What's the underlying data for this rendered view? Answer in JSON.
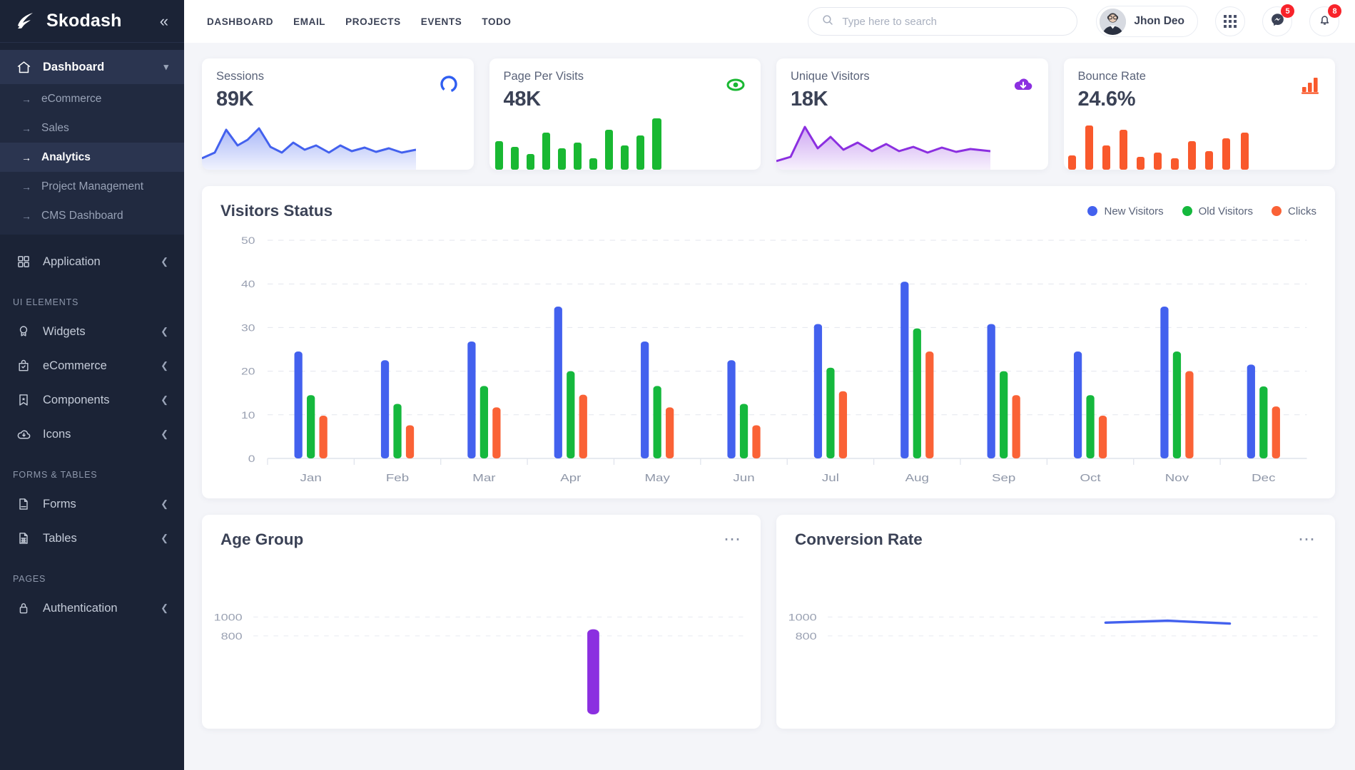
{
  "sidebar": {
    "brand": "Skodash",
    "collapse_icon": "chevron-double-left-icon",
    "groups": [
      {
        "icon": "home-icon",
        "label": "Dashboard",
        "caret": "chevron-down-icon",
        "expanded": true,
        "children": [
          {
            "label": "eCommerce",
            "selected": false
          },
          {
            "label": "Sales",
            "selected": false
          },
          {
            "label": "Analytics",
            "selected": true
          },
          {
            "label": "Project Management",
            "selected": false
          },
          {
            "label": "CMS Dashboard",
            "selected": false
          }
        ]
      }
    ],
    "application": {
      "icon": "grid-squares-icon",
      "label": "Application",
      "caret": "chevron-left-icon"
    },
    "section_ui_elements": "UI ELEMENTS",
    "ui_items": [
      {
        "icon": "badge-icon",
        "label": "Widgets",
        "caret": "chevron-left-icon"
      },
      {
        "icon": "shopping-bag-icon",
        "label": "eCommerce",
        "caret": "chevron-left-icon"
      },
      {
        "icon": "bookmark-star-icon",
        "label": "Components",
        "caret": "chevron-left-icon"
      },
      {
        "icon": "cloud-download-icon",
        "label": "Icons",
        "caret": "chevron-left-icon"
      }
    ],
    "section_forms_tables": "FORMS & TABLES",
    "forms_items": [
      {
        "icon": "file-icon",
        "label": "Forms",
        "caret": "chevron-left-icon"
      },
      {
        "icon": "table-icon",
        "label": "Tables",
        "caret": "chevron-left-icon"
      }
    ],
    "section_pages": "PAGES",
    "pages_items": [
      {
        "icon": "lock-icon",
        "label": "Authentication",
        "caret": "chevron-left-icon"
      }
    ]
  },
  "topbar": {
    "nav": [
      "DASHBOARD",
      "EMAIL",
      "PROJECTS",
      "EVENTS",
      "TODO"
    ],
    "search": {
      "placeholder": "Type here to search",
      "value": "",
      "icon": "search-icon"
    },
    "profile": {
      "name": "Jhon Deo",
      "avatar": "user-avatar"
    },
    "apps_icon": "apps-grid-icon",
    "messages": {
      "icon": "messenger-icon",
      "badge": "5"
    },
    "notifications": {
      "icon": "bell-icon",
      "badge": "8"
    }
  },
  "stats": [
    {
      "label": "Sessions",
      "value": "89K",
      "icon": "circle-ring-icon",
      "color": "#4361ee",
      "spark": "area"
    },
    {
      "label": "Page Per Visits",
      "value": "48K",
      "icon": "eye-icon",
      "color": "#19b832",
      "spark": "bars"
    },
    {
      "label": "Unique Visitors",
      "value": "18K",
      "icon": "cloud-download-icon",
      "color": "#8b2fe0",
      "spark": "area"
    },
    {
      "label": "Bounce Rate",
      "value": "24.6%",
      "icon": "bar-chart-icon",
      "color": "#f9592c",
      "spark": "bars"
    }
  ],
  "visitors_card": {
    "title": "Visitors Status",
    "legend": [
      {
        "label": "New Visitors",
        "color": "#4361ee"
      },
      {
        "label": "Old Visitors",
        "color": "#15b83d"
      },
      {
        "label": "Clicks",
        "color": "#fa6236"
      }
    ]
  },
  "bottom": {
    "age_group": {
      "title": "Age Group",
      "menu_icon": "ellipsis-icon"
    },
    "conversion_rate": {
      "title": "Conversion Rate",
      "menu_icon": "ellipsis-icon"
    }
  },
  "chart_data": [
    {
      "id": "visitors_status",
      "type": "bar",
      "title": "Visitors Status",
      "xlabel": "",
      "ylabel": "",
      "ylim": [
        0,
        50
      ],
      "yticks": [
        0,
        10,
        20,
        30,
        40,
        50
      ],
      "grid": true,
      "legend_position": "top-right",
      "categories": [
        "Jan",
        "Feb",
        "Mar",
        "Apr",
        "May",
        "Jun",
        "Jul",
        "Aug",
        "Sep",
        "Oct",
        "Nov",
        "Dec"
      ],
      "series": [
        {
          "name": "New Visitors",
          "color": "#4361ee",
          "values": [
            24.5,
            22.5,
            26.8,
            34.8,
            26.8,
            22.5,
            30.8,
            40.5,
            30.8,
            24.5,
            34.8,
            21.5
          ]
        },
        {
          "name": "Old Visitors",
          "color": "#15b83d",
          "values": [
            14.5,
            12.5,
            16.6,
            20.0,
            16.6,
            12.5,
            20.8,
            29.8,
            20.0,
            14.5,
            24.5,
            16.5
          ]
        },
        {
          "name": "Clicks",
          "color": "#fa6236",
          "values": [
            9.8,
            7.6,
            11.7,
            14.6,
            11.7,
            7.6,
            15.4,
            24.5,
            14.5,
            9.8,
            20.0,
            11.9
          ]
        }
      ]
    },
    {
      "id": "age_group",
      "type": "bar",
      "title": "Age Group",
      "ylim": [
        0,
        1000
      ],
      "yticks": [
        800,
        1000
      ],
      "grid": true,
      "categories": [
        "",
        "",
        "",
        "",
        "",
        "",
        "",
        ""
      ],
      "series": [
        {
          "name": "Age Group",
          "color": "#8b2fe0",
          "values": [
            0,
            0,
            0,
            0,
            0,
            870,
            0,
            0
          ]
        }
      ]
    },
    {
      "id": "conversion_rate",
      "type": "line",
      "title": "Conversion Rate",
      "ylim": [
        0,
        1000
      ],
      "yticks": [
        800,
        1000
      ],
      "grid": true,
      "categories": [
        "",
        "",
        "",
        "",
        "",
        "",
        "",
        ""
      ],
      "series": [
        {
          "name": "Conversion Rate",
          "color": "#4361ee",
          "values": [
            null,
            null,
            null,
            null,
            940,
            960,
            930,
            null
          ]
        }
      ]
    }
  ]
}
